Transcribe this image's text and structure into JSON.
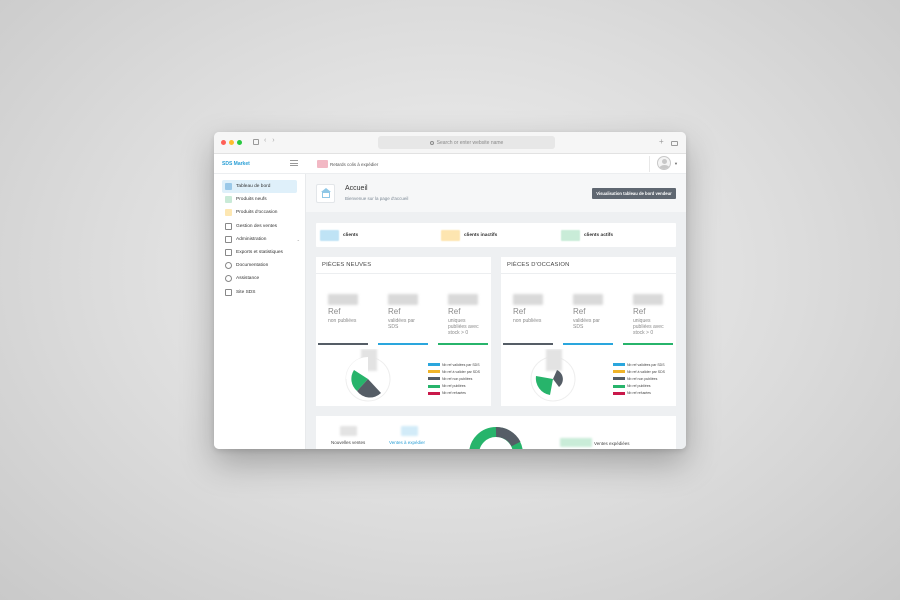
{
  "browser": {
    "address_placeholder": "Search or enter website name"
  },
  "app": {
    "brand": "SDS Market",
    "alert_text": "Retards colis à expédier"
  },
  "sidebar": {
    "items": [
      {
        "label": "Tableau de bord",
        "icon": "dashboard-icon",
        "active": true
      },
      {
        "label": "Produits neufs",
        "icon": "new-products-icon"
      },
      {
        "label": "Produits d'occasion",
        "icon": "used-products-icon"
      },
      {
        "label": "Gestion des ventes",
        "icon": "cart-icon"
      },
      {
        "label": "Administration",
        "icon": "admin-icon"
      },
      {
        "label": "Exports et statistiques",
        "icon": "chart-line-icon"
      },
      {
        "label": "Documentation",
        "icon": "info-icon"
      },
      {
        "label": "Assistance",
        "icon": "help-icon"
      },
      {
        "label": "Site SDS",
        "icon": "external-link-icon"
      }
    ]
  },
  "page": {
    "title": "Accueil",
    "subtitle": "Bienvenue sur la page d'accueil",
    "vendor_button": "Visualisation tableau de bord vendeur"
  },
  "stats": [
    {
      "label": "clients",
      "color": "#bfe3f5"
    },
    {
      "label": "clients inactifs",
      "color": "#fde5b0"
    },
    {
      "label": "clients actifs",
      "color": "#c9ecd8"
    }
  ],
  "panels": [
    {
      "title": "PIÈCES NEUVES",
      "cards": [
        {
          "ref": "Ref",
          "desc": "non publiées",
          "bar_color": "#555d66"
        },
        {
          "ref": "Ref",
          "desc": "validées par SDS",
          "bar_color": "#2aa6dd"
        },
        {
          "ref": "Ref",
          "desc": "uniques publiées avec stock > 0",
          "bar_color": "#27b46b"
        }
      ]
    },
    {
      "title": "PIÈCES D'OCCASION",
      "cards": [
        {
          "ref": "Ref",
          "desc": "non publiées",
          "bar_color": "#555d66"
        },
        {
          "ref": "Ref",
          "desc": "validées par SDS",
          "bar_color": "#2aa6dd"
        },
        {
          "ref": "Ref",
          "desc": "uniques publiées avec stock > 0",
          "bar_color": "#27b46b"
        }
      ]
    }
  ],
  "legend": [
    {
      "label": "Nb ref validées par SDS",
      "color": "#2aa6dd"
    },
    {
      "label": "Nb ref à valider par SDS",
      "color": "#f0b429"
    },
    {
      "label": "Nb ref non publiées",
      "color": "#555d66"
    },
    {
      "label": "Nb ref publiées",
      "color": "#27b46b"
    },
    {
      "label": "Nb ref refusées",
      "color": "#c9184a"
    }
  ],
  "sales": {
    "new_sales": "Nouvelles ventes",
    "to_ship": "Ventes à expédier",
    "shipped": "Ventes expédiées"
  },
  "colors": {
    "accent": "#2aa6dd",
    "success": "#27b46b",
    "dark": "#555d66",
    "warning": "#f0b429",
    "danger": "#c9184a"
  }
}
